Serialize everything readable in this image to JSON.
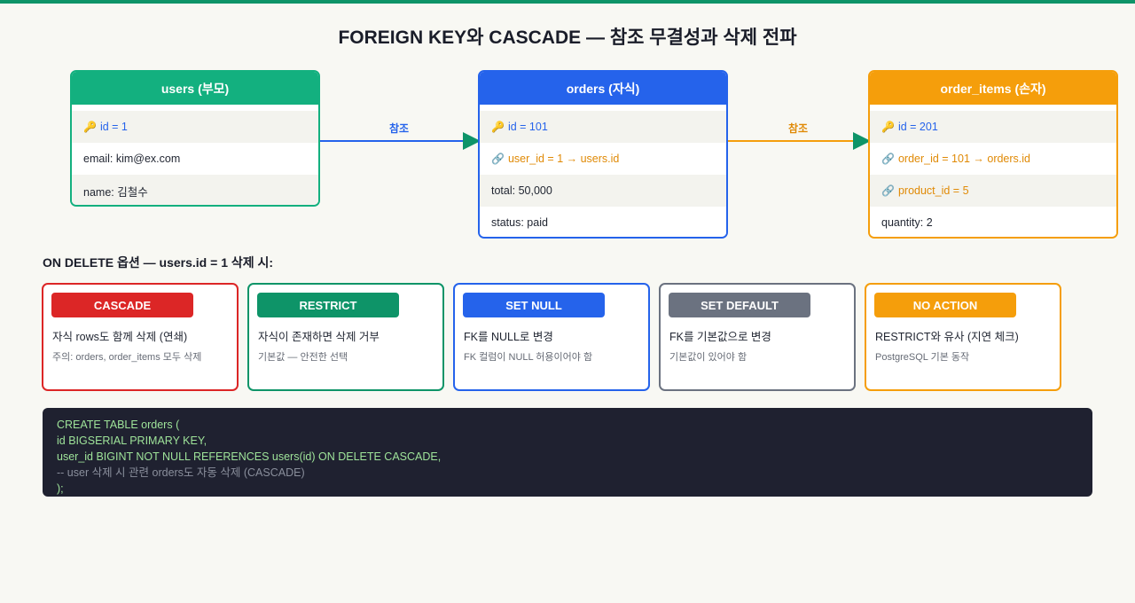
{
  "title": "FOREIGN KEY와 CASCADE — 참조 무결성과 삭제 전파",
  "tables": {
    "users": {
      "header": "users (부모)",
      "rows": [
        "id = 1",
        "email: kim@ex.com",
        "name: 김철수"
      ]
    },
    "orders": {
      "header": "orders (자식)",
      "rows": [
        "id = 101",
        "user_id = 1 → users.id",
        "total: 50,000",
        "status: paid"
      ]
    },
    "order_items": {
      "header": "order_items (손자)",
      "rows": [
        "id = 201",
        "order_id = 101 → orders.id",
        "product_id = 5",
        "quantity: 2"
      ]
    }
  },
  "edges": {
    "users_orders": "참조",
    "orders_items": "참조"
  },
  "icons": {
    "primary_key": "key-icon",
    "foreign_key": "link-icon"
  },
  "section_label": "ON DELETE 옵션 — users.id = 1 삭제 시:",
  "options": [
    {
      "name": "CASCADE",
      "desc": "자식 rows도 함께 삭제 (연쇄)",
      "note": "주의: orders, order_items 모두 삭제",
      "color": "#dc2626"
    },
    {
      "name": "RESTRICT",
      "desc": "자식이 존재하면 삭제 거부",
      "note": "기본값 — 안전한 선택",
      "color": "#0e9468"
    },
    {
      "name": "SET NULL",
      "desc": "FK를 NULL로 변경",
      "note": "FK 컬럼이 NULL 허용이어야 함",
      "color": "#2563eb"
    },
    {
      "name": "SET DEFAULT",
      "desc": "FK를 기본값으로 변경",
      "note": "기본값이 있어야 함",
      "color": "#6b7280"
    },
    {
      "name": "NO ACTION",
      "desc": "RESTRICT와 유사 (지연 체크)",
      "note": "PostgreSQL 기본 동작",
      "color": "#f59e0b"
    }
  ],
  "code": [
    "CREATE TABLE orders (",
    "id BIGSERIAL PRIMARY KEY,",
    "user_id BIGINT NOT NULL REFERENCES users(id) ON DELETE CASCADE,",
    "-- user 삭제 시 관련 orders도 자동 삭제 (CASCADE)",
    ");"
  ],
  "colors": {
    "parent": "#13b07f",
    "child": "#2563eb",
    "grandchild": "#f59e0b",
    "code_bg": "#1f2130",
    "code_text": "#9fe49a"
  }
}
